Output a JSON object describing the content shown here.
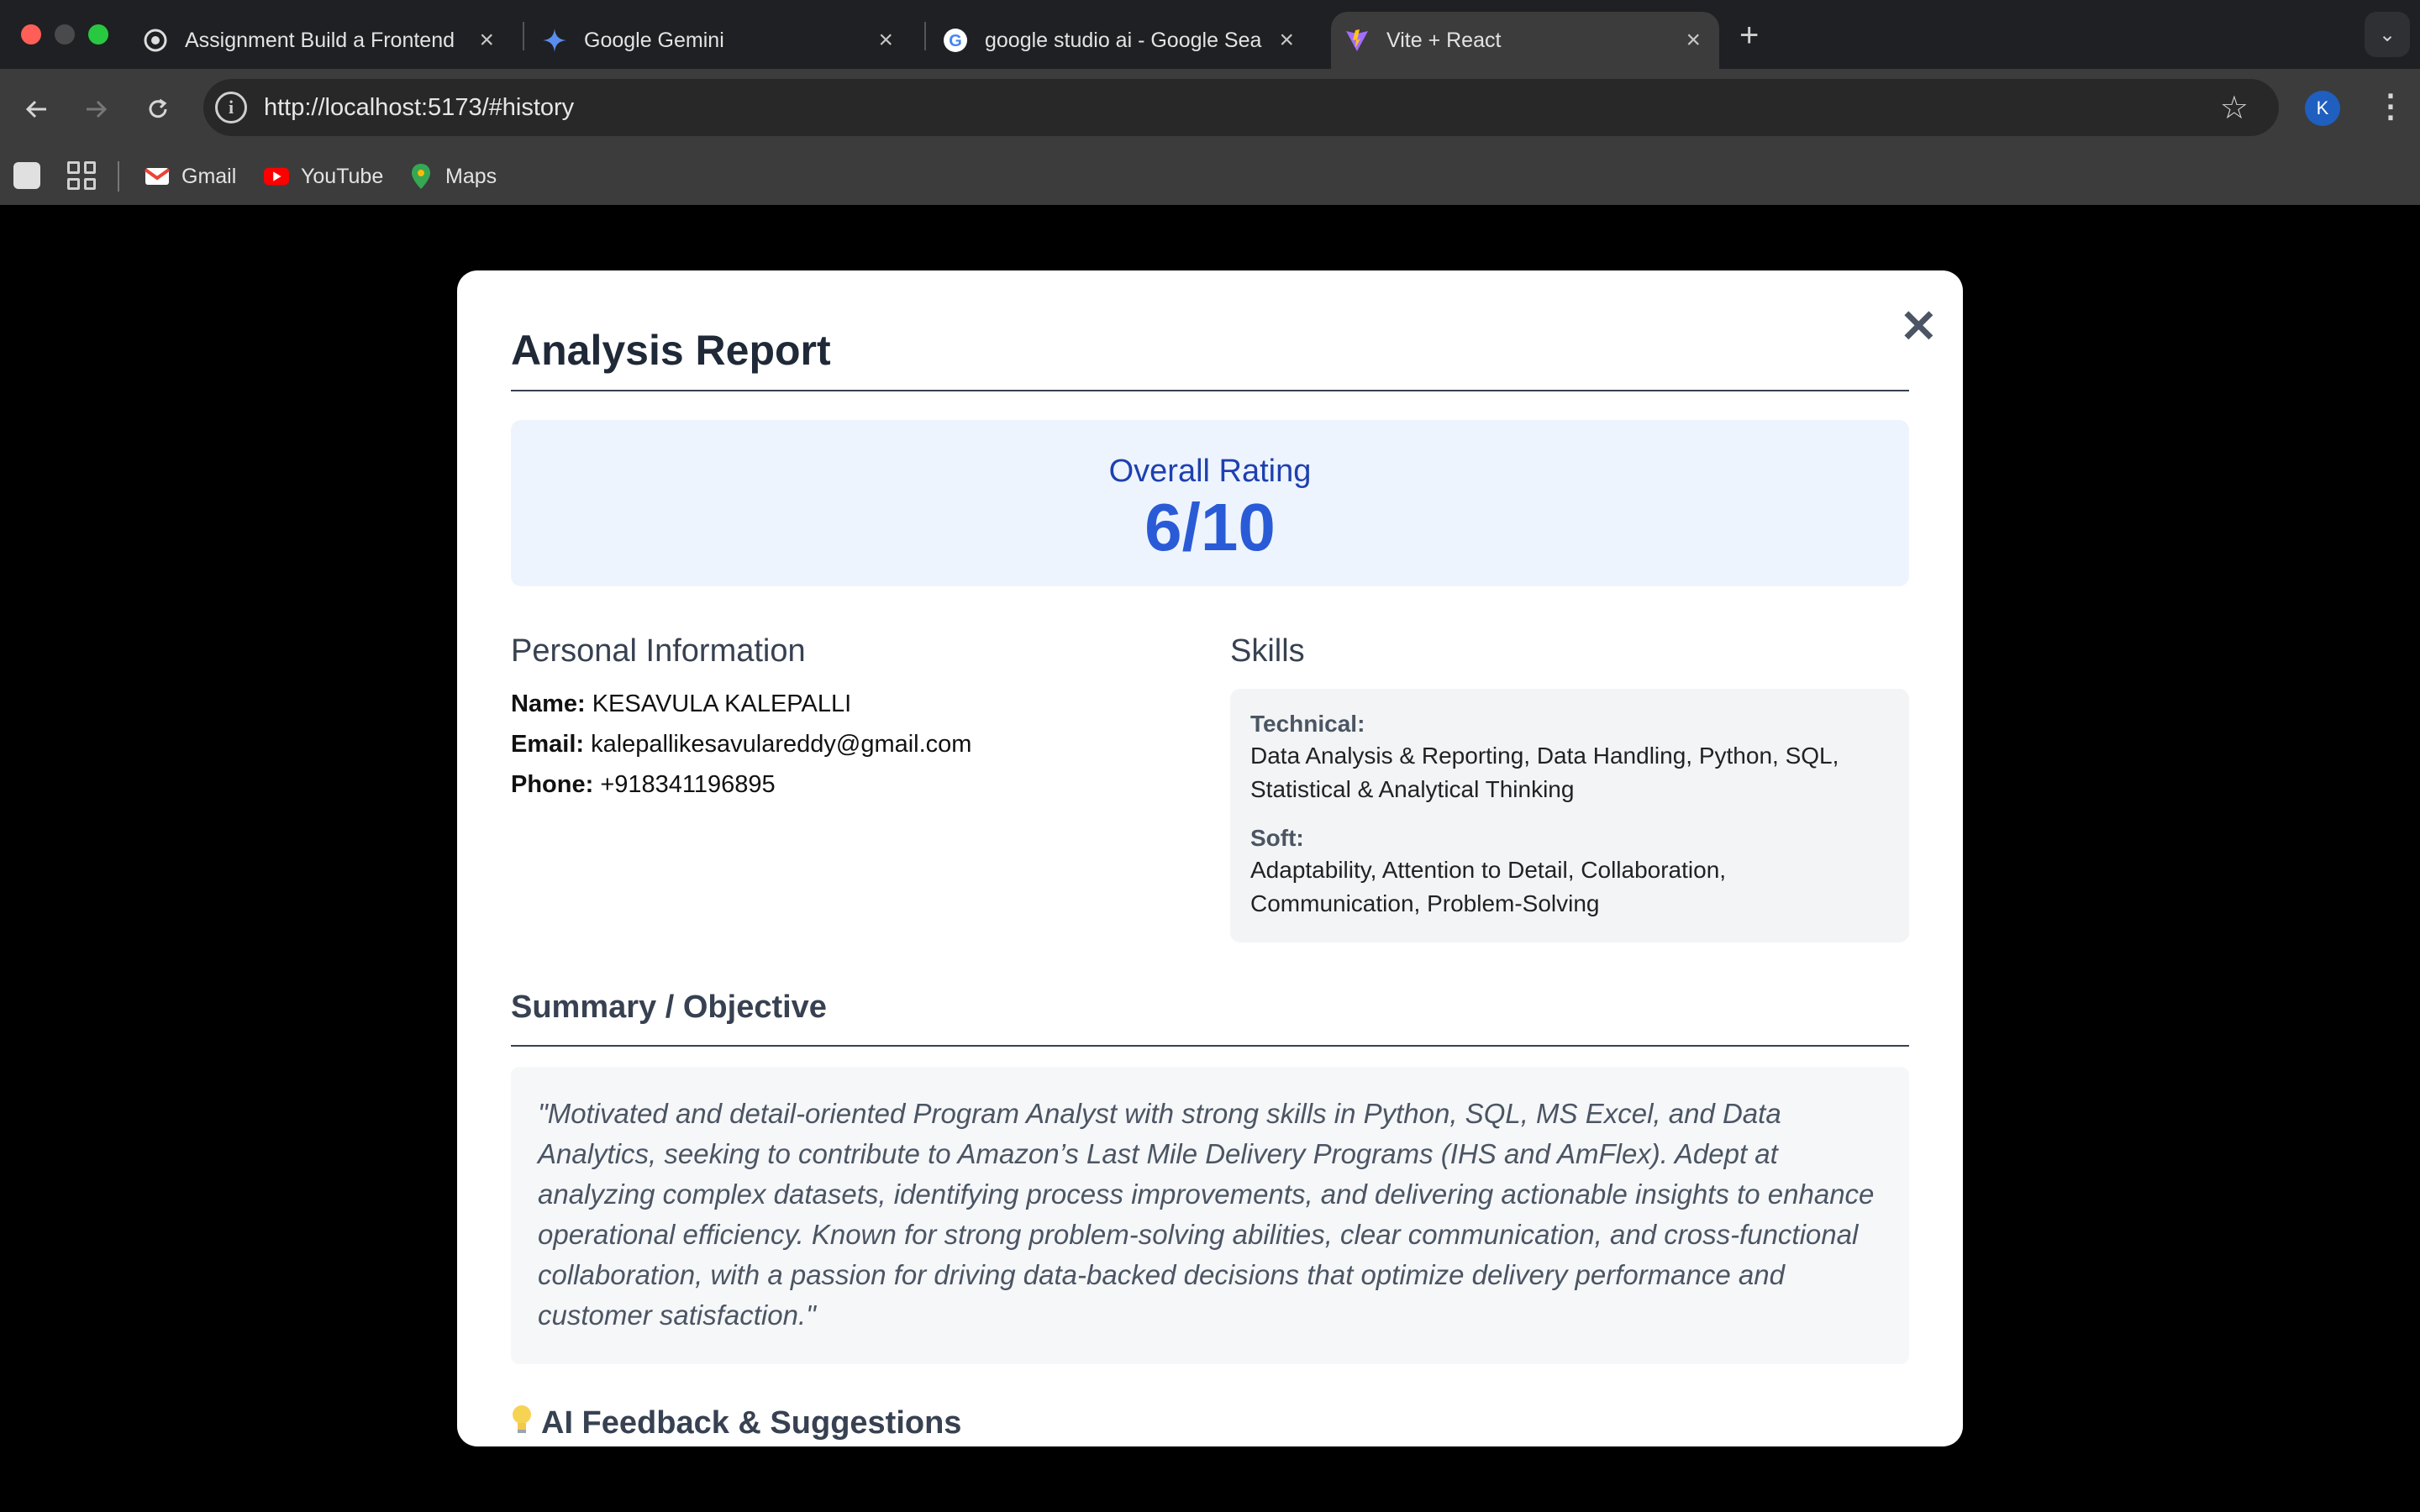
{
  "browser": {
    "tabs": [
      {
        "title": "Assignment Build a Frontend",
        "icon": "github-icon",
        "active": false
      },
      {
        "title": "Google Gemini",
        "icon": "gemini-icon",
        "active": false
      },
      {
        "title": "google studio ai - Google Sea",
        "icon": "google-icon",
        "active": false
      },
      {
        "title": "Vite + React",
        "icon": "vite-icon",
        "active": true
      }
    ],
    "url": "http://localhost:5173/#history",
    "profile_initial": "K",
    "bookmarks": [
      {
        "label": "Gmail",
        "icon": "gmail-icon"
      },
      {
        "label": "YouTube",
        "icon": "youtube-icon"
      },
      {
        "label": "Maps",
        "icon": "maps-icon"
      }
    ]
  },
  "modal": {
    "title": "Analysis Report",
    "close_glyph": "✕",
    "rating": {
      "label": "Overall Rating",
      "value": "6/10"
    },
    "personal": {
      "heading": "Personal Information",
      "name_label": "Name:",
      "name": "KESAVULA KALEPALLI",
      "email_label": "Email:",
      "email": "kalepallikesavulareddy@gmail.com",
      "phone_label": "Phone:",
      "phone": "+918341196895"
    },
    "skills": {
      "heading": "Skills",
      "technical_label": "Technical:",
      "technical": "Data Analysis & Reporting, Data Handling, Python, SQL, Statistical & Analytical Thinking",
      "soft_label": "Soft:",
      "soft": "Adaptability, Attention to Detail, Collaboration, Communication, Problem-Solving"
    },
    "summary": {
      "heading": "Summary / Objective",
      "text": "\"Motivated and detail-oriented Program Analyst with strong skills in Python, SQL, MS Excel, and Data Analytics, seeking to contribute to Amazon’s Last Mile Delivery Programs (IHS and AmFlex). Adept at analyzing complex datasets, identifying process improvements, and delivering actionable insights to enhance operational efficiency. Known for strong problem-solving abilities, clear communication, and cross-functional collaboration, with a passion for driving data-backed decisions that optimize delivery performance and customer satisfaction.\""
    },
    "feedback": {
      "heading": "AI Feedback & Suggestions",
      "icon": "lightbulb-icon"
    }
  }
}
